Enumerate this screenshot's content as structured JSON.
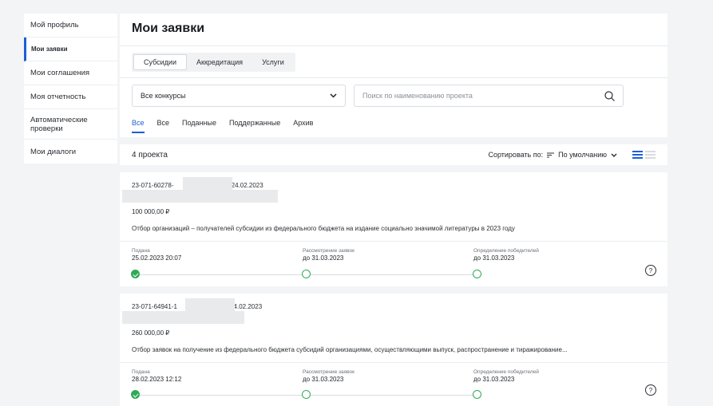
{
  "sidebar": {
    "items": [
      {
        "label": "Мой профиль"
      },
      {
        "label": "Мои заявки"
      },
      {
        "label": "Мои соглашения"
      },
      {
        "label": "Моя отчетность"
      },
      {
        "label": "Автоматические проверки"
      },
      {
        "label": "Мои диалоги"
      }
    ]
  },
  "header": {
    "title": "Мои заявки",
    "tabs": [
      "Субсидии",
      "Аккредитация",
      "Услуги"
    ],
    "contest_select": "Все конкурсы",
    "search_placeholder": "Поиск по наименованию проекта",
    "filters": [
      "Все",
      "Все",
      "Поданные",
      "Поддержанные",
      "Архив"
    ]
  },
  "toolbar": {
    "count": "4 проекта",
    "sort_label": "Сортировать по:",
    "sort_value": "По умолчанию"
  },
  "cards": [
    {
      "number": "23-071-60278-",
      "date": "от 24.02.2023",
      "amount": "100 000,00 ₽",
      "description": "Отбор организаций – получателей субсидии из федерального бюджета на издание социально значимой литературы в 2023 году",
      "stages": [
        {
          "label": "Подана",
          "value": "25.02.2023 20:07",
          "done": true
        },
        {
          "label": "Рассмотрение заявок",
          "value": "до 31.03.2023",
          "done": false
        },
        {
          "label": "Определение победителей",
          "value": "до 31.03.2023",
          "done": false
        }
      ]
    },
    {
      "number": "23-071-64941-1",
      "date": "от 24.02.2023",
      "amount": "260 000,00 ₽",
      "description": "Отбор заявок на получение из федерального бюджета субсидий организациями, осуществляющими выпуск, распространение и тиражирование...",
      "stages": [
        {
          "label": "Подана",
          "value": "28.02.2023 12:12",
          "done": true
        },
        {
          "label": "Рассмотрение заявок",
          "value": "до 31.03.2023",
          "done": false
        },
        {
          "label": "Определение победителей",
          "value": "до 31.03.2023",
          "done": false
        }
      ]
    }
  ],
  "colors": {
    "accent": "#1b5fd6",
    "success": "#2faa57"
  }
}
